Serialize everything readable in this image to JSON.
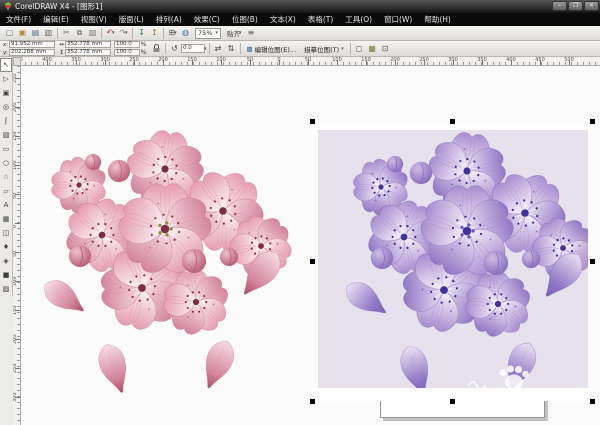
{
  "window": {
    "title": "CorelDRAW X4 - [图形1]",
    "buttons": {
      "minimize": "–",
      "maximize": "❐",
      "close": "×"
    }
  },
  "menu_bar": {
    "items": [
      {
        "name": "file",
        "label": "文件(F)"
      },
      {
        "name": "edit",
        "label": "编辑(E)"
      },
      {
        "name": "view",
        "label": "视图(V)"
      },
      {
        "name": "layout",
        "label": "版面(L)"
      },
      {
        "name": "arrange",
        "label": "排列(A)"
      },
      {
        "name": "effects",
        "label": "效果(C)"
      },
      {
        "name": "bitmaps",
        "label": "位图(B)"
      },
      {
        "name": "text",
        "label": "文本(X)"
      },
      {
        "name": "table",
        "label": "表格(T)"
      },
      {
        "name": "tools",
        "label": "工具(O)"
      },
      {
        "name": "window",
        "label": "窗口(W)"
      },
      {
        "name": "help",
        "label": "帮助(H)"
      }
    ]
  },
  "standard_toolbar": {
    "zoom_level": "75%",
    "snap_label": "贴齐",
    "buttons": [
      {
        "name": "new",
        "glyph": "▢",
        "color": "#5b6f87"
      },
      {
        "name": "open",
        "glyph": "▣",
        "color": "#b08a3e"
      },
      {
        "name": "save",
        "glyph": "▤",
        "color": "#5b6f87"
      },
      {
        "name": "print",
        "glyph": "▥",
        "color": "#666666"
      },
      {
        "type": "sep"
      },
      {
        "name": "cut",
        "glyph": "✂",
        "color": "#666666"
      },
      {
        "name": "copy",
        "glyph": "⧉",
        "color": "#666666"
      },
      {
        "name": "paste",
        "glyph": "▧",
        "color": "#777777"
      },
      {
        "type": "sep"
      },
      {
        "name": "undo",
        "glyph": "↶",
        "color": "#a43c3c",
        "dropdown": true
      },
      {
        "name": "redo",
        "glyph": "↷",
        "color": "#888888",
        "dropdown": true
      },
      {
        "type": "sep"
      },
      {
        "name": "import",
        "glyph": "↧",
        "color": "#3a7d4f"
      },
      {
        "name": "export",
        "glyph": "↥",
        "color": "#a86a2c"
      },
      {
        "type": "sep"
      },
      {
        "name": "application-launcher",
        "glyph": "⊞",
        "color": "#555555",
        "dropdown": true
      },
      {
        "name": "corel-online",
        "glyph": "◍",
        "color": "#3a6ea5"
      },
      {
        "type": "zoom-combo"
      },
      {
        "type": "snap"
      },
      {
        "name": "options",
        "glyph": "≡",
        "color": "#555555"
      }
    ]
  },
  "property_bar": {
    "x_label": "x:",
    "x_value": "91.952 mm",
    "y_label": "y:",
    "y_value": "202.288 mm",
    "width_value": "352.778 mm",
    "height_value": "352.778 mm",
    "scale_x": "100.0",
    "percent_x": "%",
    "scale_y": "100.0",
    "percent_y": "%",
    "rotation_value": "0.0",
    "edit_bitmap_label": "编辑位图(E)...",
    "trace_bitmap_label": "描摹位图(T)"
  },
  "rulers": {
    "h_labels": [
      "450",
      "400",
      "350",
      "300",
      "250",
      "200",
      "150",
      "100",
      "50",
      "0",
      "50",
      "100",
      "150",
      "200",
      "250",
      "300",
      "350",
      "400",
      "450",
      "500"
    ],
    "v_labels": [
      "250",
      "200",
      "150",
      "100",
      "50",
      "0",
      "50",
      "100",
      "150",
      "200",
      "250",
      "300"
    ]
  },
  "toolbox": {
    "tools": [
      {
        "name": "pick-tool",
        "glyph": "↖",
        "active": true
      },
      {
        "name": "shape-tool",
        "glyph": "▷"
      },
      {
        "name": "crop-tool",
        "glyph": "▣"
      },
      {
        "name": "zoom-tool",
        "glyph": "◎"
      },
      {
        "name": "freehand-tool",
        "glyph": "ʃ"
      },
      {
        "name": "smart-fill-tool",
        "glyph": "▧"
      },
      {
        "name": "rectangle-tool",
        "glyph": "▭"
      },
      {
        "name": "ellipse-tool",
        "glyph": "○"
      },
      {
        "name": "polygon-tool",
        "glyph": "☆"
      },
      {
        "name": "basic-shapes-tool",
        "glyph": "▱"
      },
      {
        "name": "text-tool",
        "glyph": "A"
      },
      {
        "name": "table-tool",
        "glyph": "▦"
      },
      {
        "name": "blend-tool",
        "glyph": "◫"
      },
      {
        "name": "eyedropper-tool",
        "glyph": "♦"
      },
      {
        "name": "outline-tool",
        "glyph": "◈"
      },
      {
        "name": "fill-tool",
        "glyph": "■"
      },
      {
        "name": "interactive-fill-tool",
        "glyph": "▨"
      }
    ]
  },
  "artwork": {
    "canvas_bg": "#fcfbfb",
    "page_border": "#98948f",
    "pink": {
      "petal_light_base": "#fdf3f6",
      "petal_light_tip": "#e49cb1",
      "petal_mid_base": "#f8dde5",
      "petal_mid_tip": "#d2839c",
      "edge": "#c06e86",
      "vein": "#d98ca0",
      "center": "#7c2d44",
      "stamen": "#fcf2ea",
      "dot": "#8e2f40",
      "anther": "#8a8d3a",
      "bud_light": "#efc0cd",
      "bud_deep": "#ab4763",
      "background": "none"
    },
    "purple": {
      "petal_light_base": "#f7f3fa",
      "petal_light_tip": "#a88ccf",
      "petal_mid_base": "#eae2f4",
      "petal_mid_tip": "#9176c3",
      "edge": "#7e64b2",
      "vein": "#a48bd0",
      "center": "#41309e",
      "stamen": "#f1edfa",
      "dot": "#392b92",
      "anther": "#6456b8",
      "bud_light": "#cdbce4",
      "bud_deep": "#7a5cb4",
      "background": "#e6e1ec"
    }
  }
}
